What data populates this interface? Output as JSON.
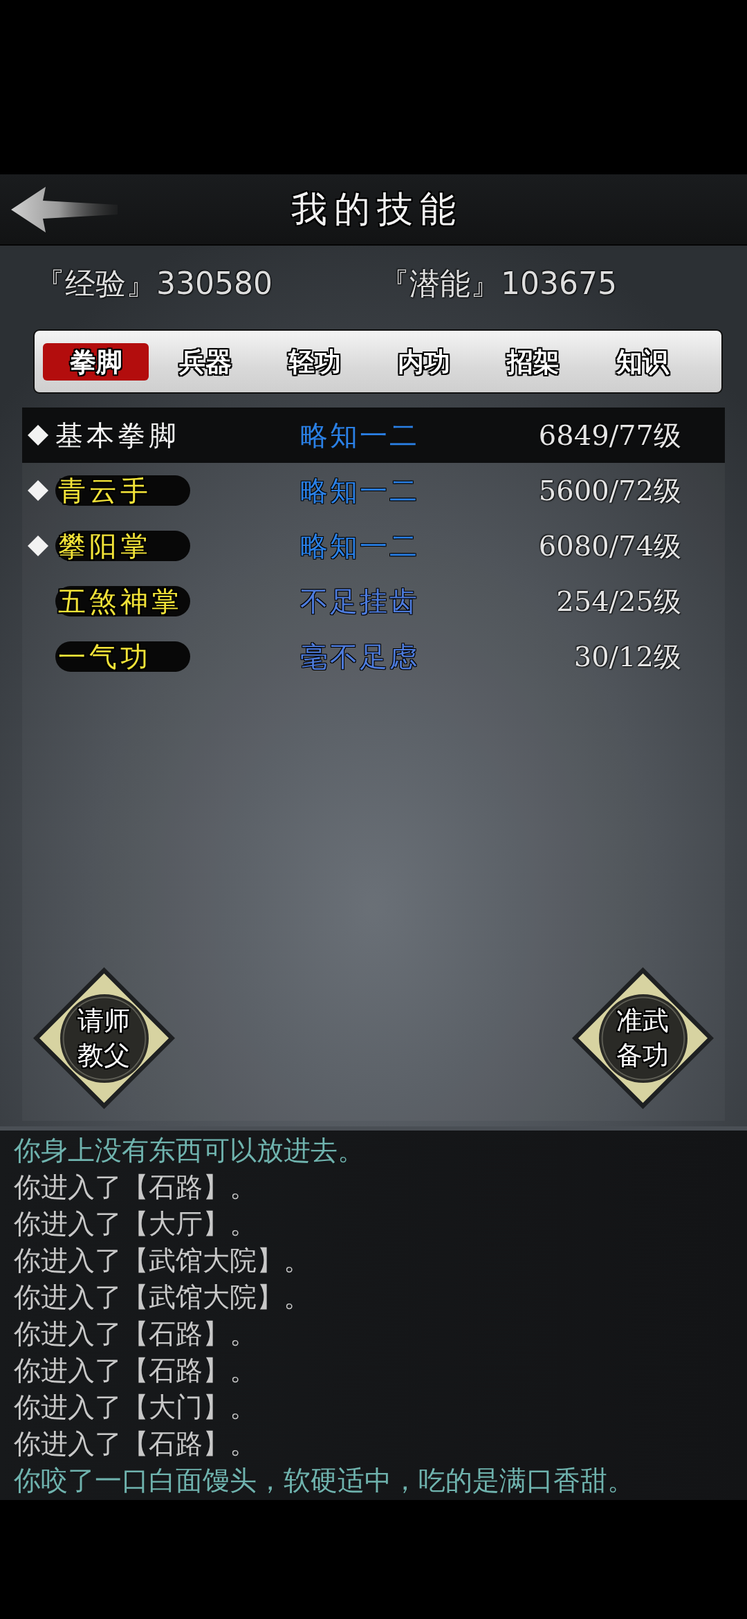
{
  "header": {
    "title": "我的技能"
  },
  "stats": [
    {
      "label": "『经验』",
      "value": "330580"
    },
    {
      "label": "『潜能』",
      "value": "103675"
    }
  ],
  "tabs": [
    {
      "label": "拳脚",
      "selected": true
    },
    {
      "label": "兵器",
      "selected": false
    },
    {
      "label": "轻功",
      "selected": false
    },
    {
      "label": "内功",
      "selected": false
    },
    {
      "label": "招架",
      "selected": false
    },
    {
      "label": "知识",
      "selected": false
    }
  ],
  "skills": [
    {
      "name": "基本拳脚",
      "equipped": true,
      "selected": true,
      "rank": "略知一二",
      "color": "#2a80e6",
      "progress": "6849/77级"
    },
    {
      "name": "青云手",
      "equipped": true,
      "selected": false,
      "rank": "略知一二",
      "color": "#2a80e6",
      "progress": "5600/72级"
    },
    {
      "name": "攀阳掌",
      "equipped": true,
      "selected": false,
      "rank": "略知一二",
      "color": "#2a80e6",
      "progress": "6080/74级"
    },
    {
      "name": "五煞神掌",
      "equipped": false,
      "selected": false,
      "rank": "不足挂齿",
      "color": "#4d7bdc",
      "progress": "254/25级"
    },
    {
      "name": "一气功",
      "equipped": false,
      "selected": false,
      "rank": "毫不足虑",
      "color": "#4d7bdc",
      "progress": "30/12级"
    }
  ],
  "actions": [
    {
      "label": "请师教父"
    },
    {
      "label": "准武备功"
    }
  ],
  "log": [
    {
      "text": "你身上没有东西可以放进去。",
      "color": "#6fb3ae"
    },
    {
      "text": "你进入了【石路】。",
      "color": "#c8c8c8"
    },
    {
      "text": "你进入了【大厅】。",
      "color": "#c8c8c8"
    },
    {
      "text": "你进入了【武馆大院】。",
      "color": "#c8c8c8"
    },
    {
      "text": "你进入了【武馆大院】。",
      "color": "#c8c8c8"
    },
    {
      "text": "你进入了【石路】。",
      "color": "#c8c8c8"
    },
    {
      "text": "你进入了【石路】。",
      "color": "#c8c8c8"
    },
    {
      "text": "你进入了【大门】。",
      "color": "#c8c8c8"
    },
    {
      "text": "你进入了【石路】。",
      "color": "#c8c8c8"
    },
    {
      "text": "你咬了一口白面馒头，软硬适中，吃的是满口香甜。",
      "color": "#6fb3ae"
    }
  ]
}
